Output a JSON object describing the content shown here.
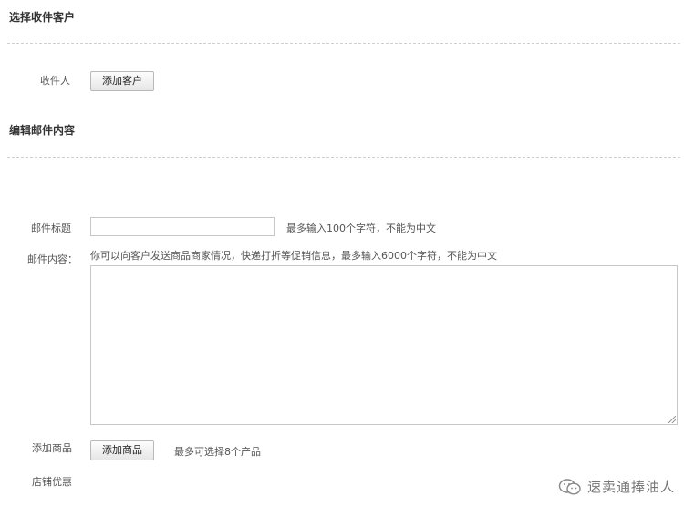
{
  "sections": {
    "recipient_title": "选择收件客户",
    "content_title": "编辑邮件内容"
  },
  "recipient": {
    "label": "收件人",
    "add_button": "添加客户"
  },
  "mail": {
    "subject_label": "邮件标题",
    "subject_value": "",
    "subject_hint": "最多输入100个字符，不能为中文",
    "body_label": "邮件内容：",
    "body_hint": "你可以向客户发送商品商家情况，快递打折等促销信息，最多输入6000个字符，不能为中文",
    "body_value": ""
  },
  "products": {
    "label": "添加商品",
    "add_button": "添加商品",
    "hint": "最多可选择8个产品"
  },
  "store": {
    "label": "店铺优惠"
  },
  "watermark": {
    "text": "速卖通捧油人",
    "icon": "wechat-icon"
  }
}
